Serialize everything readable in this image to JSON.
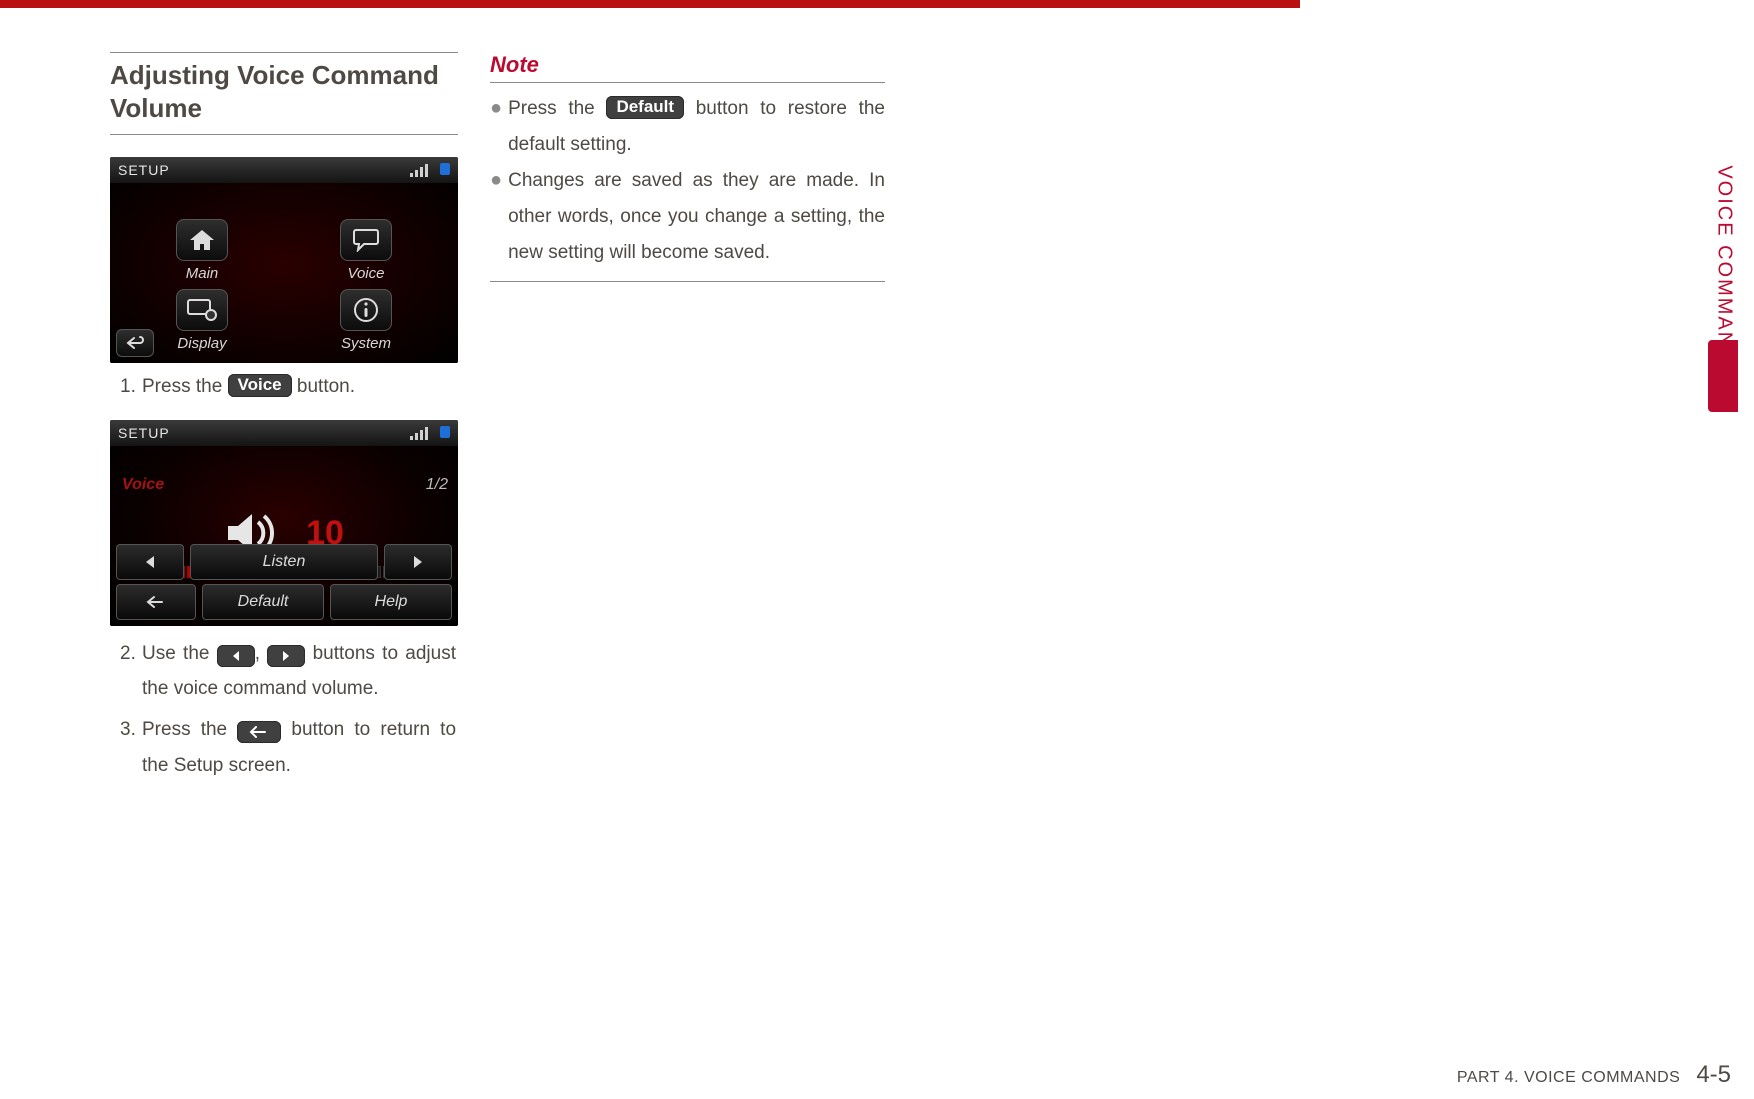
{
  "header_section": "Adjusting Voice Command Volume",
  "screenshot1": {
    "title": "SETUP",
    "items": [
      "Main",
      "Voice",
      "Display",
      "System"
    ]
  },
  "step1": {
    "num": "1.",
    "pre": "Press the ",
    "pill": "Voice",
    "post": " button."
  },
  "screenshot2": {
    "title": "SETUP",
    "voice_label": "Voice",
    "page_indicator": "1/2",
    "volume_value": "10",
    "listen": "Listen",
    "default": "Default",
    "help": "Help"
  },
  "step2": {
    "num": "2.",
    "pre": "Use the ",
    "mid": ", ",
    "post": " buttons to adjust the voice command volume."
  },
  "step3": {
    "num": "3.",
    "pre": "Press the ",
    "post": " button to return to the Setup screen."
  },
  "note": {
    "heading": "Note",
    "b1_pre": "Press the ",
    "b1_pill": "Default",
    "b1_post": " button to restore the default setting.",
    "b2": "Changes are saved as they are made. In other words, once you change a setting, the new setting will become saved."
  },
  "side_label": "VOICE COMMANDS",
  "footer": {
    "text": "PART 4. VOICE COMMANDS",
    "page": "4-5"
  }
}
